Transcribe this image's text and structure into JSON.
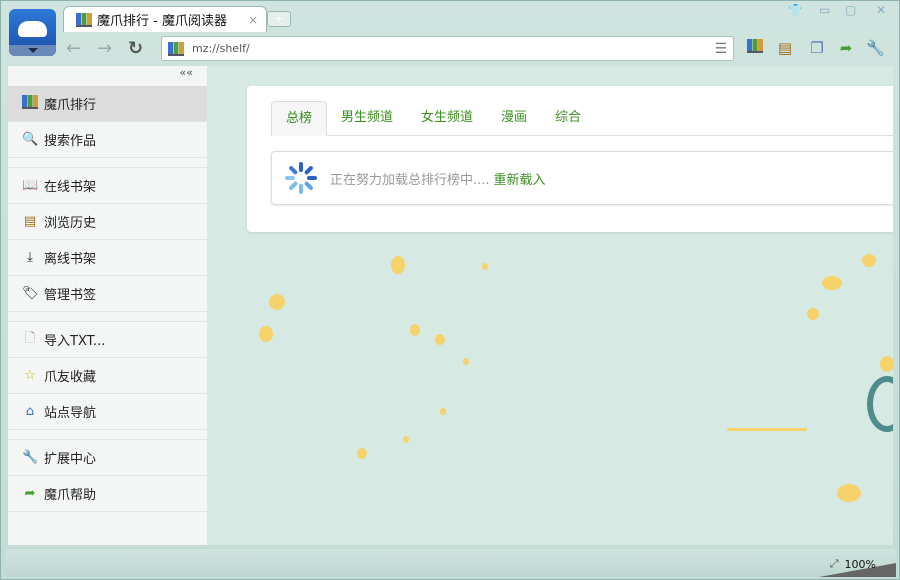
{
  "window": {
    "minimize_icon": "minimize-icon",
    "maximize_icon": "maximize-icon",
    "close_icon": "close-icon",
    "skin_icon": "tshirt-icon"
  },
  "tab": {
    "title": "魔爪排行 - 魔爪阅读器",
    "close": "×",
    "new_tab": "+"
  },
  "nav": {
    "back": "←",
    "forward": "→",
    "reload": "↻"
  },
  "address": {
    "url": "mz://shelf/"
  },
  "sidebar": {
    "collapse": "««",
    "items": [
      {
        "label": "魔爪排行",
        "icon": "chart-icon",
        "active": true
      },
      {
        "label": "搜索作品",
        "icon": "search-icon"
      },
      {
        "label": "在线书架",
        "icon": "book-icon"
      },
      {
        "label": "浏览历史",
        "icon": "history-icon"
      },
      {
        "label": "离线书架",
        "icon": "download-icon"
      },
      {
        "label": "管理书签",
        "icon": "tag-icon"
      },
      {
        "label": "导入TXT...",
        "icon": "file-icon"
      },
      {
        "label": "爪友收藏",
        "icon": "star-icon"
      },
      {
        "label": "站点导航",
        "icon": "home-icon"
      },
      {
        "label": "扩展中心",
        "icon": "wrench-icon"
      },
      {
        "label": "魔爪帮助",
        "icon": "help-icon"
      }
    ]
  },
  "content": {
    "tabs": [
      "总榜",
      "男生频道",
      "女生频道",
      "漫画",
      "综合"
    ],
    "active_tab": 0,
    "loading_text": "正在努力加载总排行榜中....",
    "reload_link": "重新载入"
  },
  "status": {
    "zoom": "100%"
  }
}
